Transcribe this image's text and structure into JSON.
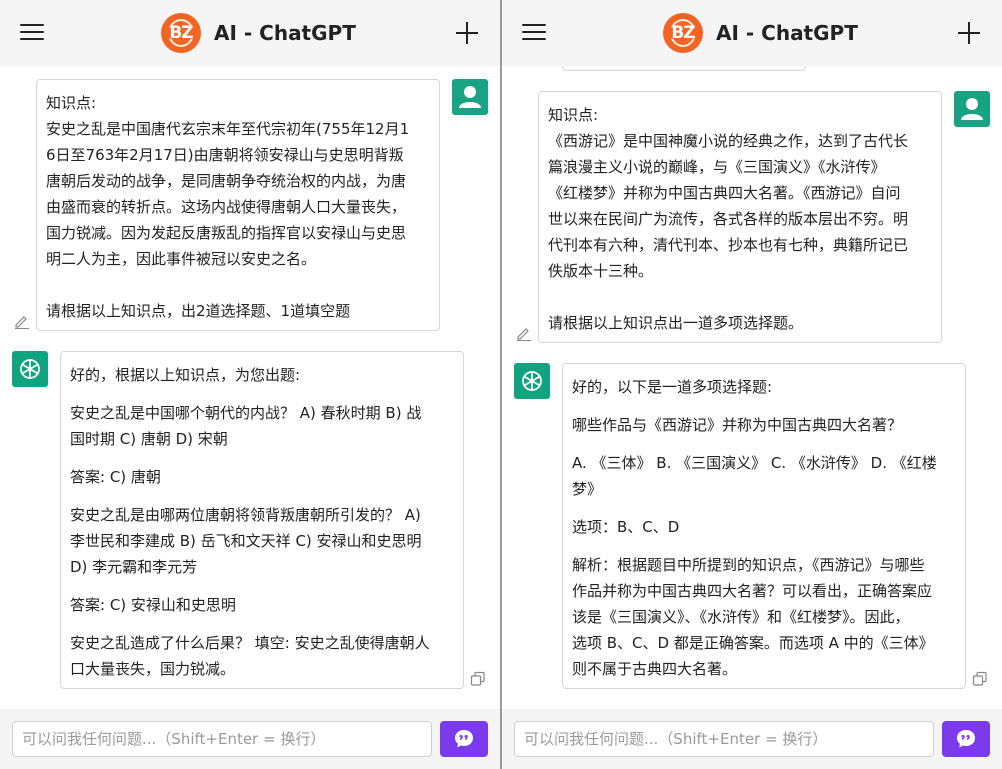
{
  "panes": [
    {
      "header": {
        "title": "AI - ChatGPT",
        "logo_text": "BZ"
      },
      "messages": [
        {
          "role": "user",
          "lines": [
            "知识点:",
            "安史之乱是中国唐代玄宗末年至代宗初年(755年12月1",
            "6日至763年2月17日)由唐朝将领安禄山与史思明背叛",
            "唐朝后发动的战争，是同唐朝争夺统治权的内战，为唐",
            "由盛而衰的转折点。这场内战使得唐朝人口大量丧失，",
            "国力锐减。因为发起反唐叛乱的指挥官以安禄山与史思",
            "明二人为主，因此事件被冠以安史之名。",
            "",
            "请根据以上知识点，出2道选择题、1道填空题"
          ]
        },
        {
          "role": "assistant",
          "paragraphs": [
            [
              "好的，根据以上知识点，为您出题:"
            ],
            [
              "安史之乱是中国哪个朝代的内战？ A) 春秋时期 B) 战",
              "国时期 C) 唐朝 D) 宋朝"
            ],
            [
              "答案: C) 唐朝"
            ],
            [
              "安史之乱是由哪两位唐朝将领背叛唐朝所引发的？ A)",
              "李世民和李建成 B) 岳飞和文天祥 C) 安禄山和史思明",
              "D) 李元霸和李元芳"
            ],
            [
              "答案: C) 安禄山和史思明"
            ],
            [
              "安史之乱造成了什么后果？ 填空: 安史之乱使得唐朝人",
              "口大量丧失，国力锐减。"
            ]
          ]
        }
      ],
      "input": {
        "placeholder": "可以问我任何问题...（Shift+Enter = 换行）",
        "value": ""
      }
    },
    {
      "header": {
        "title": "AI - ChatGPT",
        "logo_text": "BZ"
      },
      "messages": [
        {
          "role": "user",
          "lines": [
            "知识点:",
            "《西游记》是中国神魔小说的经典之作，达到了古代长",
            "篇浪漫主义小说的巅峰，与《三国演义》《水浒传》",
            "《红楼梦》并称为中国古典四大名著。《西游记》自问",
            "世以来在民间广为流传，各式各样的版本层出不穷。明",
            "代刊本有六种，清代刊本、抄本也有七种，典籍所记已",
            "佚版本十三种。",
            "",
            "请根据以上知识点出一道多项选择题。"
          ]
        },
        {
          "role": "assistant",
          "paragraphs": [
            [
              "好的，以下是一道多项选择题:"
            ],
            [
              "哪些作品与《西游记》并称为中国古典四大名著？"
            ],
            [
              "A. 《三体》 B. 《三国演义》 C. 《水浒传》 D. 《红楼",
              "梦》"
            ],
            [
              "选项：B、C、D"
            ],
            [
              "解析：根据题目中所提到的知识点，《西游记》与哪些",
              "作品并称为中国古典四大名著？可以看出，正确答案应",
              "该是《三国演义》、《水浒传》和《红楼梦》。因此，",
              "选项 B、C、D 都是正确答案。而选项 A 中的《三体》",
              "则不属于古典四大名著。"
            ]
          ]
        }
      ],
      "input": {
        "placeholder": "可以问我任何问题...（Shift+Enter = 换行）",
        "value": ""
      }
    }
  ],
  "icons": {
    "menu": "hamburger-menu-icon",
    "new_chat": "plus-icon",
    "user_avatar": "user-icon",
    "bot_avatar": "openai-logo-icon",
    "edit": "pencil-icon",
    "copy": "copy-icon",
    "send": "chat-bubble-icon"
  },
  "colors": {
    "logo": "#f26522",
    "user_avatar": "#19a383",
    "bot_avatar": "#0fa37f",
    "send_button": "#7c3aed",
    "header_bg": "#f5f5f5"
  }
}
